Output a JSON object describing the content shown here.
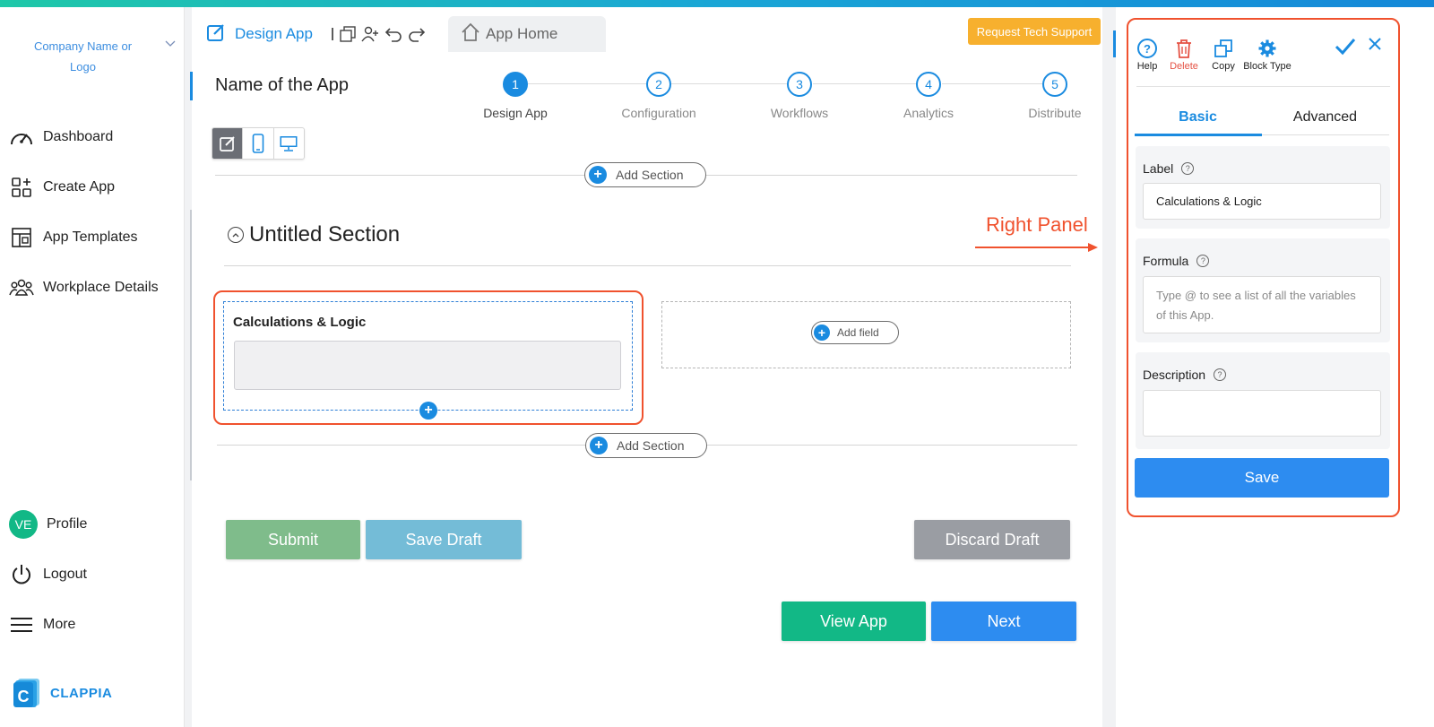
{
  "colors": {
    "accent": "#1a8be0",
    "annotation": "#f0522e",
    "tech_support": "#f7b02e",
    "submit": "#7fbc8b",
    "save_draft": "#74bcd7",
    "discard": "#9a9da3",
    "view_app": "#12b886",
    "next": "#2d8cf0"
  },
  "sidebar": {
    "company": "Company Name or Logo",
    "items": [
      {
        "label": "Dashboard",
        "icon": "dashboard-icon"
      },
      {
        "label": "Create App",
        "icon": "create-app-icon"
      },
      {
        "label": "App Templates",
        "icon": "templates-icon"
      },
      {
        "label": "Workplace Details",
        "icon": "people-icon"
      }
    ],
    "profile": {
      "initials": "VE",
      "label": "Profile"
    },
    "logout": "Logout",
    "more": "More",
    "brand": "CLAPPIA"
  },
  "header": {
    "design_tab": "Design App",
    "home_tab": "App Home",
    "tech_support": "Request Tech Support"
  },
  "app_name": "Name of the App",
  "steps": [
    {
      "num": "1",
      "label": "Design App"
    },
    {
      "num": "2",
      "label": "Configuration"
    },
    {
      "num": "3",
      "label": "Workflows"
    },
    {
      "num": "4",
      "label": "Analytics"
    },
    {
      "num": "5",
      "label": "Distribute"
    }
  ],
  "canvas": {
    "add_section": "Add Section",
    "section_title": "Untitled Section",
    "field_label": "Calculations & Logic",
    "add_field": "Add field"
  },
  "buttons": {
    "submit": "Submit",
    "save_draft": "Save Draft",
    "discard_draft": "Discard Draft",
    "view_app": "View App",
    "next": "Next"
  },
  "annotation": "Right Panel",
  "right_panel": {
    "tools": {
      "help": "Help",
      "delete": "Delete",
      "copy": "Copy",
      "block_type": "Block Type"
    },
    "tabs": {
      "basic": "Basic",
      "advanced": "Advanced"
    },
    "label_title": "Label",
    "label_value": "Calculations & Logic",
    "formula_title": "Formula",
    "formula_placeholder": "Type @ to see a list of all the variables of this App.",
    "description_title": "Description",
    "description_value": "",
    "save": "Save"
  }
}
